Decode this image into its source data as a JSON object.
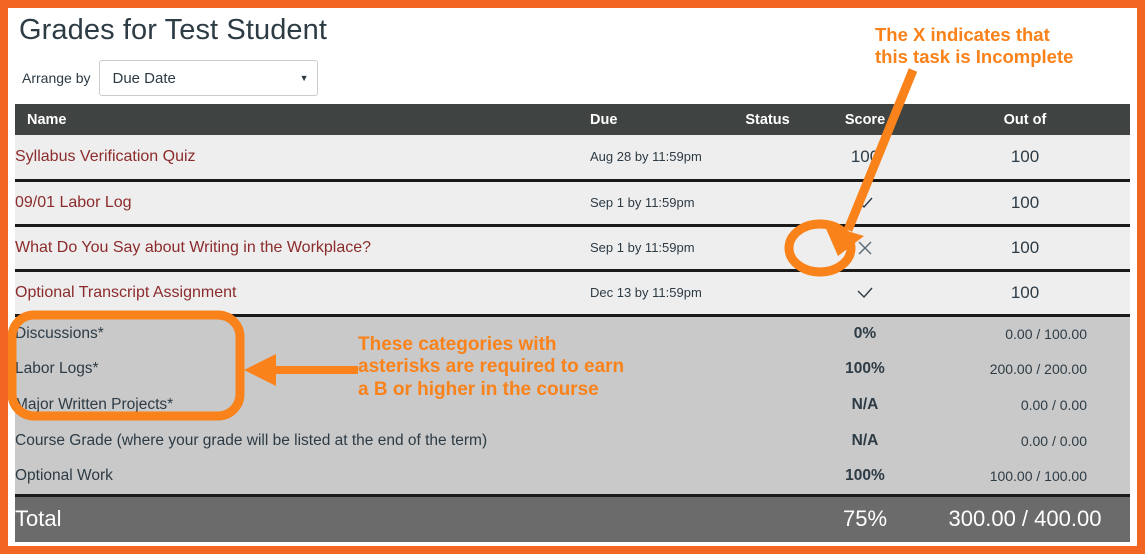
{
  "page": {
    "title": "Grades for Test Student",
    "accent_color": "#f26522",
    "annotation_color": "#f9821a",
    "header_bg": "#3f4341",
    "row_bg": "#eeeeee",
    "category_bg": "#c9c9c9",
    "total_bg": "#6b6b6b",
    "link_color": "#8c2b2b"
  },
  "arrange": {
    "label": "Arrange by",
    "selected": "Due Date",
    "caret": "▼"
  },
  "table": {
    "headers": {
      "name": "Name",
      "due": "Due",
      "status": "Status",
      "score": "Score",
      "out_of": "Out of"
    },
    "assignments": [
      {
        "name": "Syllabus Verification Quiz",
        "due": "Aug 28 by 11:59pm",
        "status": "",
        "score": "100",
        "score_icon": "",
        "out_of": "100"
      },
      {
        "name": "09/01 Labor Log",
        "due": "Sep 1 by 11:59pm",
        "status": "",
        "score": "",
        "score_icon": "check-icon",
        "out_of": "100"
      },
      {
        "name": "What Do You Say about Writing in the Workplace?",
        "due": "Sep 1 by 11:59pm",
        "status": "",
        "score": "",
        "score_icon": "x-icon",
        "out_of": "100"
      },
      {
        "name": "Optional Transcript Assignment",
        "due": "Dec 13 by 11:59pm",
        "status": "",
        "score": "",
        "score_icon": "check-icon",
        "out_of": "100"
      }
    ],
    "categories": [
      {
        "name": "Discussions*",
        "percent": "0%",
        "out_of": "0.00 / 100.00"
      },
      {
        "name": "Labor Logs*",
        "percent": "100%",
        "out_of": "200.00 / 200.00"
      },
      {
        "name": "Major Written Projects*",
        "percent": "N/A",
        "out_of": "0.00 / 0.00"
      },
      {
        "name": "Course Grade (where your grade will be listed at the end of the term)",
        "percent": "N/A",
        "out_of": "0.00 / 0.00"
      },
      {
        "name": "Optional Work",
        "percent": "100%",
        "out_of": "100.00 / 100.00"
      }
    ],
    "total": {
      "label": "Total",
      "percent": "75%",
      "out_of": "300.00 / 400.00"
    }
  },
  "annotations": {
    "incomplete_note": "The X indicates that\nthis task is Incomplete",
    "asterisk_note": "These categories with\nasterisks are required to earn\na B or higher in the course"
  }
}
